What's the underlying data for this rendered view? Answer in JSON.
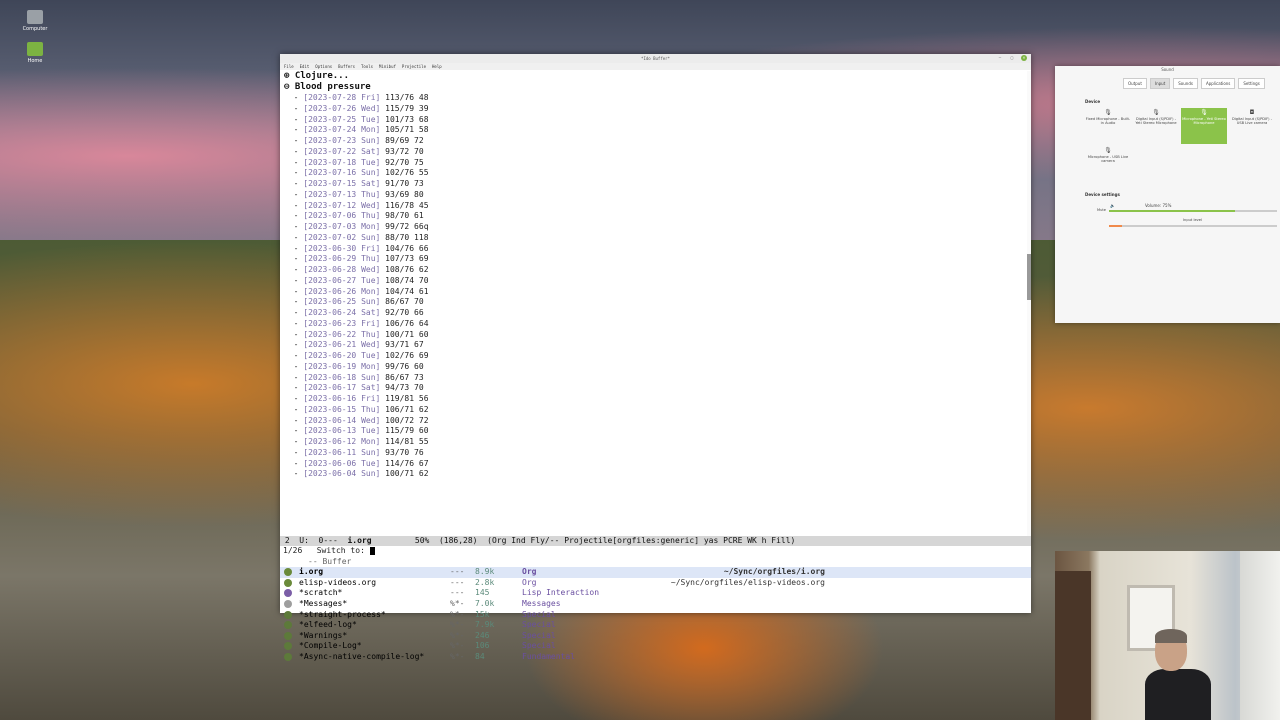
{
  "desktop": {
    "icons": [
      {
        "label": "Computer",
        "icon": "computer-icon",
        "color": "#9aa0a6"
      },
      {
        "label": "Home",
        "icon": "folder-icon",
        "color": "#7cb342"
      }
    ]
  },
  "emacs": {
    "title": "*Ido Buffer*",
    "menu": [
      "File",
      "Edit",
      "Options",
      "Buffers",
      "Tools",
      "Minibuf",
      "Projectile",
      "Help"
    ],
    "headings": [
      "⊕ Clojure...",
      "⊖ Blood pressure"
    ],
    "bp_entries": [
      {
        "date": "[2023-07-28 Fri]",
        "reading": "113/76 48"
      },
      {
        "date": "[2023-07-26 Wed]",
        "reading": "115/79 39"
      },
      {
        "date": "[2023-07-25 Tue]",
        "reading": "101/73 68"
      },
      {
        "date": "[2023-07-24 Mon]",
        "reading": "105/71 58"
      },
      {
        "date": "[2023-07-23 Sun]",
        "reading": "89/69 72"
      },
      {
        "date": "[2023-07-22 Sat]",
        "reading": "93/72 70"
      },
      {
        "date": "[2023-07-18 Tue]",
        "reading": "92/70 75"
      },
      {
        "date": "[2023-07-16 Sun]",
        "reading": "102/76 55"
      },
      {
        "date": "[2023-07-15 Sat]",
        "reading": "91/70 73"
      },
      {
        "date": "[2023-07-13 Thu]",
        "reading": "93/69 80"
      },
      {
        "date": "[2023-07-12 Wed]",
        "reading": "116/78 45"
      },
      {
        "date": "[2023-07-06 Thu]",
        "reading": "98/70 61"
      },
      {
        "date": "[2023-07-03 Mon]",
        "reading": "99/72 66q"
      },
      {
        "date": "[2023-07-02 Sun]",
        "reading": "88/70 118"
      },
      {
        "date": "[2023-06-30 Fri]",
        "reading": "104/76 66"
      },
      {
        "date": "[2023-06-29 Thu]",
        "reading": "107/73 69"
      },
      {
        "date": "[2023-06-28 Wed]",
        "reading": "108/76 62"
      },
      {
        "date": "[2023-06-27 Tue]",
        "reading": "108/74 70"
      },
      {
        "date": "[2023-06-26 Mon]",
        "reading": "104/74 61"
      },
      {
        "date": "[2023-06-25 Sun]",
        "reading": "86/67 70"
      },
      {
        "date": "[2023-06-24 Sat]",
        "reading": "92/70 66"
      },
      {
        "date": "[2023-06-23 Fri]",
        "reading": "106/76 64"
      },
      {
        "date": "[2023-06-22 Thu]",
        "reading": "100/71 60"
      },
      {
        "date": "[2023-06-21 Wed]",
        "reading": "93/71 67"
      },
      {
        "date": "[2023-06-20 Tue]",
        "reading": "102/76 69"
      },
      {
        "date": "[2023-06-19 Mon]",
        "reading": "99/76 60"
      },
      {
        "date": "[2023-06-18 Sun]",
        "reading": "86/67 73"
      },
      {
        "date": "[2023-06-17 Sat]",
        "reading": "94/73 70"
      },
      {
        "date": "[2023-06-16 Fri]",
        "reading": "119/81 56"
      },
      {
        "date": "[2023-06-15 Thu]",
        "reading": "106/71 62"
      },
      {
        "date": "[2023-06-14 Wed]",
        "reading": "100/72 72"
      },
      {
        "date": "[2023-06-13 Tue]",
        "reading": "115/79 60"
      },
      {
        "date": "[2023-06-12 Mon]",
        "reading": "114/81 55"
      },
      {
        "date": "[2023-06-11 Sun]",
        "reading": "93/70 76"
      },
      {
        "date": "[2023-06-06 Tue]",
        "reading": "114/76 67"
      },
      {
        "date": "[2023-06-04 Sun]",
        "reading": "100/71 62"
      }
    ],
    "modeline": {
      "prefix": " 2  U:  0---  ",
      "buffer": "i.org",
      "rest": "         50%  (186,28)  (Org Ind Fly/-- Projectile[orgfiles:generic] yas PCRE WK h Fill)"
    },
    "minibuffer": {
      "prompt": "1/26   Switch to: ",
      "group": "Buffer",
      "candidates": [
        {
          "name": "i.org",
          "flags": "---",
          "size": "8.9k",
          "mode": "Org",
          "path": "~/Sync/orgfiles/i.org",
          "icon_color": "#6a8a3a",
          "selected": true
        },
        {
          "name": "elisp-videos.org",
          "flags": "---",
          "size": "2.8k",
          "mode": "Org",
          "path": "~/Sync/orgfiles/elisp-videos.org",
          "icon_color": "#6a8a3a",
          "selected": false
        },
        {
          "name": "*scratch*",
          "flags": "---",
          "size": "145",
          "mode": "Lisp Interaction",
          "path": "",
          "icon_color": "#7b5ea7",
          "selected": false
        },
        {
          "name": "*Messages*",
          "flags": "%*-",
          "size": "7.0k",
          "mode": "Messages",
          "path": "",
          "icon_color": "#9e9e9e",
          "selected": false
        },
        {
          "name": "*straight-process*",
          "flags": "%*-",
          "size": "15k",
          "mode": "Special",
          "path": "",
          "icon_color": "#5d7a3a",
          "selected": false
        },
        {
          "name": "*elfeed-log*",
          "flags": "%*-",
          "size": "7.9k",
          "mode": "Special",
          "path": "",
          "icon_color": "#5d7a3a",
          "selected": false
        },
        {
          "name": "*Warnings*",
          "flags": "%*-",
          "size": "246",
          "mode": "Special",
          "path": "",
          "icon_color": "#5d7a3a",
          "selected": false
        },
        {
          "name": "*Compile-Log*",
          "flags": "%*-",
          "size": "106",
          "mode": "Special",
          "path": "",
          "icon_color": "#5d7a3a",
          "selected": false
        },
        {
          "name": "*Async-native-compile-log*",
          "flags": "%*-",
          "size": "84",
          "mode": "Fundamental",
          "path": "",
          "icon_color": "#5d7a3a",
          "selected": false
        }
      ]
    }
  },
  "sound": {
    "title": "Sound",
    "tabs": [
      "Output",
      "Input",
      "Sounds",
      "Applications",
      "Settings"
    ],
    "active_tab": "Input",
    "device_section": "Device",
    "devices": [
      {
        "name": "Fixed Microphone - Built-in Audio",
        "icon": "microphone-icon",
        "active": false
      },
      {
        "name": "Digital Input (S/PDIF) - Yeti Stereo Microphone",
        "icon": "microphone-icon",
        "active": false
      },
      {
        "name": "Microphone - Yeti Stereo Microphone",
        "icon": "microphone-icon",
        "active": true
      },
      {
        "name": "Digital Input (S/PDIF) - USB Live camera",
        "icon": "camera-icon",
        "active": false
      },
      {
        "name": "Microphone - USB Live camera",
        "icon": "microphone-icon",
        "active": false
      }
    ],
    "settings_section": "Device settings",
    "volume_label": "Volume: 75%",
    "volume": 0.75,
    "mute_label": "Mute",
    "input_level_label": "Input level",
    "input_level": 0.08,
    "accent": "#8bc34a"
  }
}
